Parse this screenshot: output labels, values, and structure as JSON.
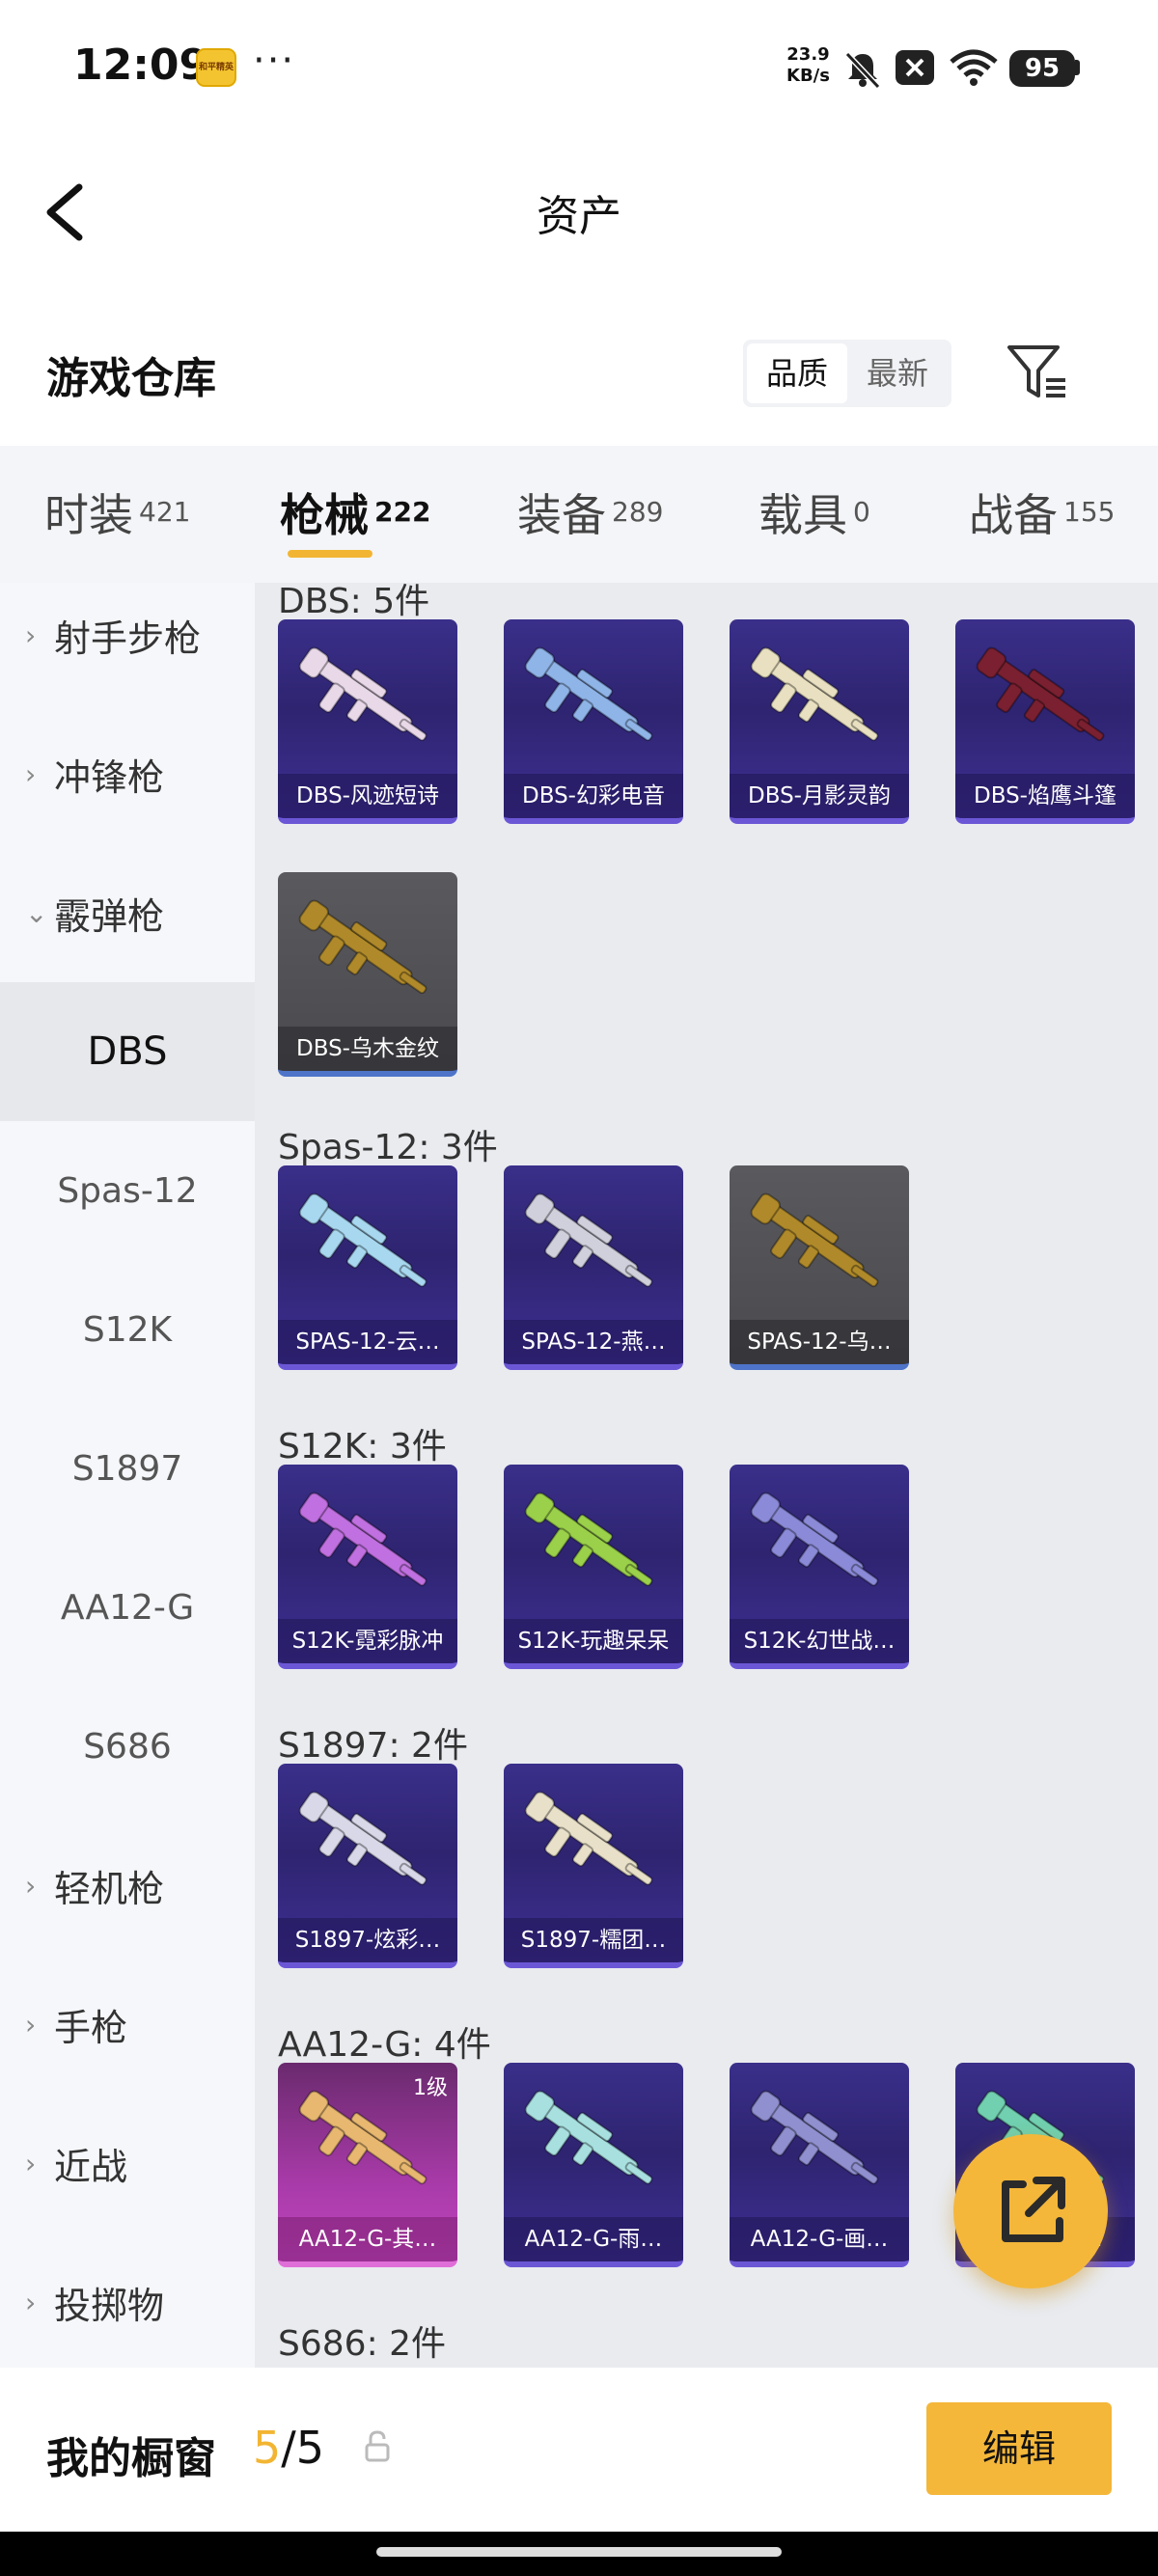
{
  "status_bar": {
    "time": "12:09",
    "app_icon_text": "和平精英",
    "more": "···",
    "net_speed_value": "23.9",
    "net_speed_unit": "KB/s",
    "battery": "95"
  },
  "header": {
    "title": "资产"
  },
  "section": {
    "title": "游戏仓库",
    "sort_options": [
      "品质",
      "最新"
    ],
    "sort_active": "品质"
  },
  "tabs": [
    {
      "label": "时装",
      "count": "421"
    },
    {
      "label": "枪械",
      "count": "222",
      "active": true
    },
    {
      "label": "装备",
      "count": "289"
    },
    {
      "label": "载具",
      "count": "0"
    },
    {
      "label": "战备",
      "count": "155"
    }
  ],
  "sidebar": {
    "items": [
      {
        "label": "射手步枪",
        "type": "category",
        "chevron": "›"
      },
      {
        "label": "冲锋枪",
        "type": "category",
        "chevron": "›"
      },
      {
        "label": "霰弹枪",
        "type": "category",
        "chevron": "⌄"
      },
      {
        "label": "DBS",
        "type": "sub",
        "active": true
      },
      {
        "label": "Spas-12",
        "type": "sub"
      },
      {
        "label": "S12K",
        "type": "sub"
      },
      {
        "label": "S1897",
        "type": "sub"
      },
      {
        "label": "AA12-G",
        "type": "sub"
      },
      {
        "label": "S686",
        "type": "sub"
      },
      {
        "label": "轻机枪",
        "type": "category",
        "chevron": "›"
      },
      {
        "label": "手枪",
        "type": "category",
        "chevron": "›"
      },
      {
        "label": "近战",
        "type": "category",
        "chevron": "›"
      },
      {
        "label": "投掷物",
        "type": "category",
        "chevron": "›"
      }
    ]
  },
  "groups": [
    {
      "title": "DBS: 5件",
      "items": [
        {
          "name": "DBS-风迹短诗",
          "style": "purple",
          "gun": "#e8d8e8"
        },
        {
          "name": "DBS-幻彩电音",
          "style": "purple",
          "gun": "#8fb4e8"
        },
        {
          "name": "DBS-月影灵韵",
          "style": "purple",
          "gun": "#e8e0c0"
        },
        {
          "name": "DBS-焰鹰斗篷",
          "style": "purple",
          "gun": "#7a2030"
        },
        {
          "name": "DBS-乌木金纹",
          "style": "gray",
          "gun": "#b08a2a"
        }
      ]
    },
    {
      "title": "Spas-12: 3件",
      "items": [
        {
          "name": "SPAS-12-云…",
          "style": "purple",
          "gun": "#a8d8f0"
        },
        {
          "name": "SPAS-12-燕…",
          "style": "purple",
          "gun": "#d0d0dc"
        },
        {
          "name": "SPAS-12-乌…",
          "style": "gray",
          "gun": "#b08a2a"
        }
      ]
    },
    {
      "title": "S12K: 3件",
      "items": [
        {
          "name": "S12K-霓彩脉冲",
          "style": "purple",
          "gun": "#c070e0"
        },
        {
          "name": "S12K-玩趣呆呆",
          "style": "purple",
          "gun": "#9ad04a"
        },
        {
          "name": "S12K-幻世战…",
          "style": "purple",
          "gun": "#8a8ad8"
        }
      ]
    },
    {
      "title": "S1897: 2件",
      "items": [
        {
          "name": "S1897-炫彩…",
          "style": "purple",
          "gun": "#d8d8e8"
        },
        {
          "name": "S1897-糯团…",
          "style": "purple",
          "gun": "#e8e0c8"
        }
      ]
    },
    {
      "title": "AA12-G: 4件",
      "items": [
        {
          "name": "AA12-G-其…",
          "style": "pink",
          "gun": "#e8b870",
          "level": "1级"
        },
        {
          "name": "AA12-G-雨…",
          "style": "purple",
          "gun": "#a8e0e0"
        },
        {
          "name": "AA12-G-画…",
          "style": "purple",
          "gun": "#9090d0"
        },
        {
          "name": "AA12-G-…",
          "style": "purple",
          "gun": "#70d0b0"
        }
      ]
    },
    {
      "title": "S686: 2件",
      "items": []
    }
  ],
  "bottom_bar": {
    "label": "我的橱窗",
    "current": "5",
    "sep": "/",
    "total": "5",
    "edit_label": "编辑"
  },
  "icons": {
    "back": "back-arrow-icon",
    "filter": "filter-icon",
    "share": "external-link-icon",
    "lock": "lock-icon"
  },
  "colors": {
    "accent": "#f2b533",
    "card_purple": "#3a2f8a",
    "card_gray": "#5a5a5e",
    "card_pink": "#a83aa8"
  }
}
